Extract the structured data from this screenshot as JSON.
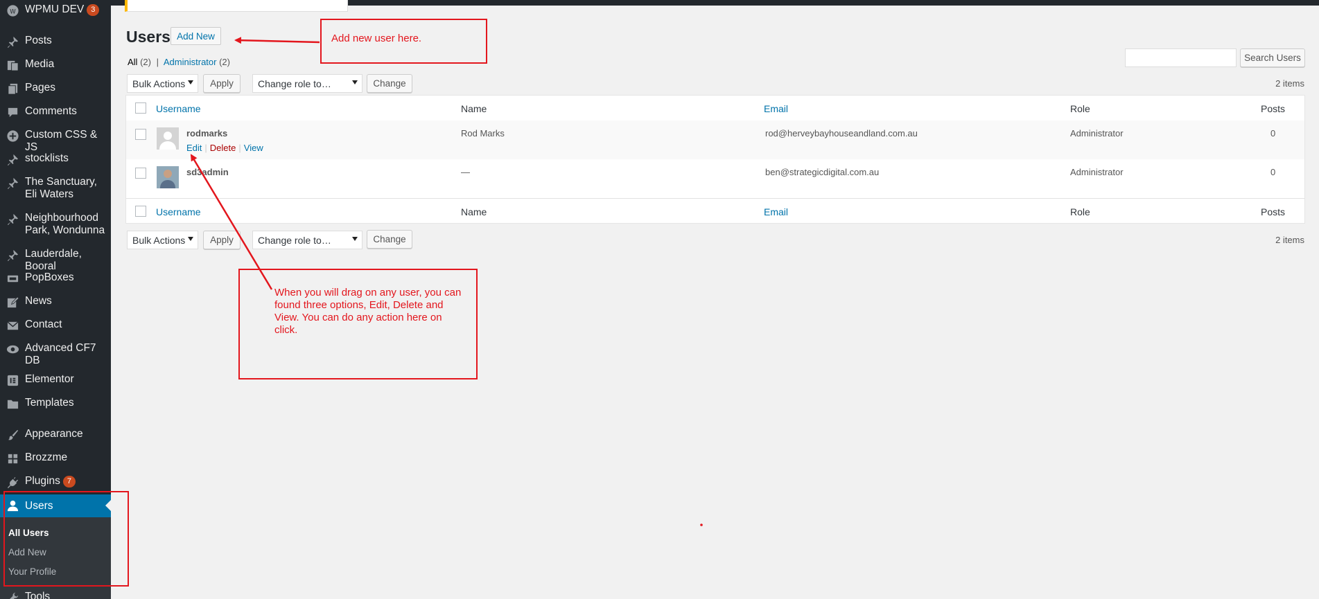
{
  "sidebar": {
    "items": [
      {
        "label": "WPMU DEV",
        "icon": "wpmudev-icon",
        "badge": "3"
      },
      {
        "label": "Posts",
        "icon": "pin-icon"
      },
      {
        "label": "Media",
        "icon": "media-icon"
      },
      {
        "label": "Pages",
        "icon": "pages-icon"
      },
      {
        "label": "Comments",
        "icon": "comment-icon"
      },
      {
        "label": "Custom CSS & JS",
        "icon": "plus-circle-icon"
      },
      {
        "label": "stocklists",
        "icon": "pin-icon"
      },
      {
        "label": "The Sanctuary, Eli Waters",
        "icon": "pin-icon"
      },
      {
        "label": "Neighbourhood Park, Wondunna",
        "icon": "pin-icon"
      },
      {
        "label": "Lauderdale, Booral",
        "icon": "pin-icon"
      },
      {
        "label": "PopBoxes",
        "icon": "popbox-icon"
      },
      {
        "label": "News",
        "icon": "edit-icon"
      },
      {
        "label": "Contact",
        "icon": "envelope-icon"
      },
      {
        "label": "Advanced CF7 DB",
        "icon": "eye-icon"
      },
      {
        "label": "Elementor",
        "icon": "elementor-icon"
      },
      {
        "label": "Templates",
        "icon": "folder-icon"
      },
      {
        "label": "Appearance",
        "icon": "brush-icon"
      },
      {
        "label": "Brozzme",
        "icon": "grid-icon"
      },
      {
        "label": "Plugins",
        "icon": "plug-icon",
        "badge": "7"
      },
      {
        "label": "Tools",
        "icon": "wrench-icon"
      }
    ],
    "active": {
      "label": "Users",
      "icon": "user-icon"
    },
    "submenu": [
      "All Users",
      "Add New",
      "Your Profile"
    ]
  },
  "header": {
    "title": "Users",
    "add_new": "Add New"
  },
  "filters": {
    "all": "All",
    "all_count": "(2)",
    "sep": "|",
    "admin": "Administrator",
    "admin_count": "(2)"
  },
  "search": {
    "button": "Search Users",
    "value": ""
  },
  "bulk": {
    "bulk_actions": "Bulk Actions",
    "apply": "Apply",
    "change_role": "Change role to…",
    "change": "Change",
    "items": "2 items"
  },
  "table": {
    "columns": [
      "Username",
      "Name",
      "Email",
      "Role",
      "Posts"
    ],
    "rows": [
      {
        "username": "rodmarks",
        "name": "Rod Marks",
        "email": "rod@herveybayhouseandland.com.au",
        "role": "Administrator",
        "posts": "0"
      },
      {
        "username": "sd3admin",
        "name": "—",
        "email": "ben@strategicdigital.com.au",
        "role": "Administrator",
        "posts": "0"
      }
    ],
    "row_actions": [
      "Edit",
      "Delete",
      "View"
    ]
  },
  "annotations": {
    "add_user": "Add new user here.",
    "drag_help": "When you will drag on any user, you can found three options, Edit, Delete and View. You can do any action here on click."
  },
  "colors": {
    "sidebar_bg": "#23282d",
    "active_blue": "#0073aa",
    "annotation_red": "#e3161d",
    "badge_orange": "#ca4a1f"
  }
}
